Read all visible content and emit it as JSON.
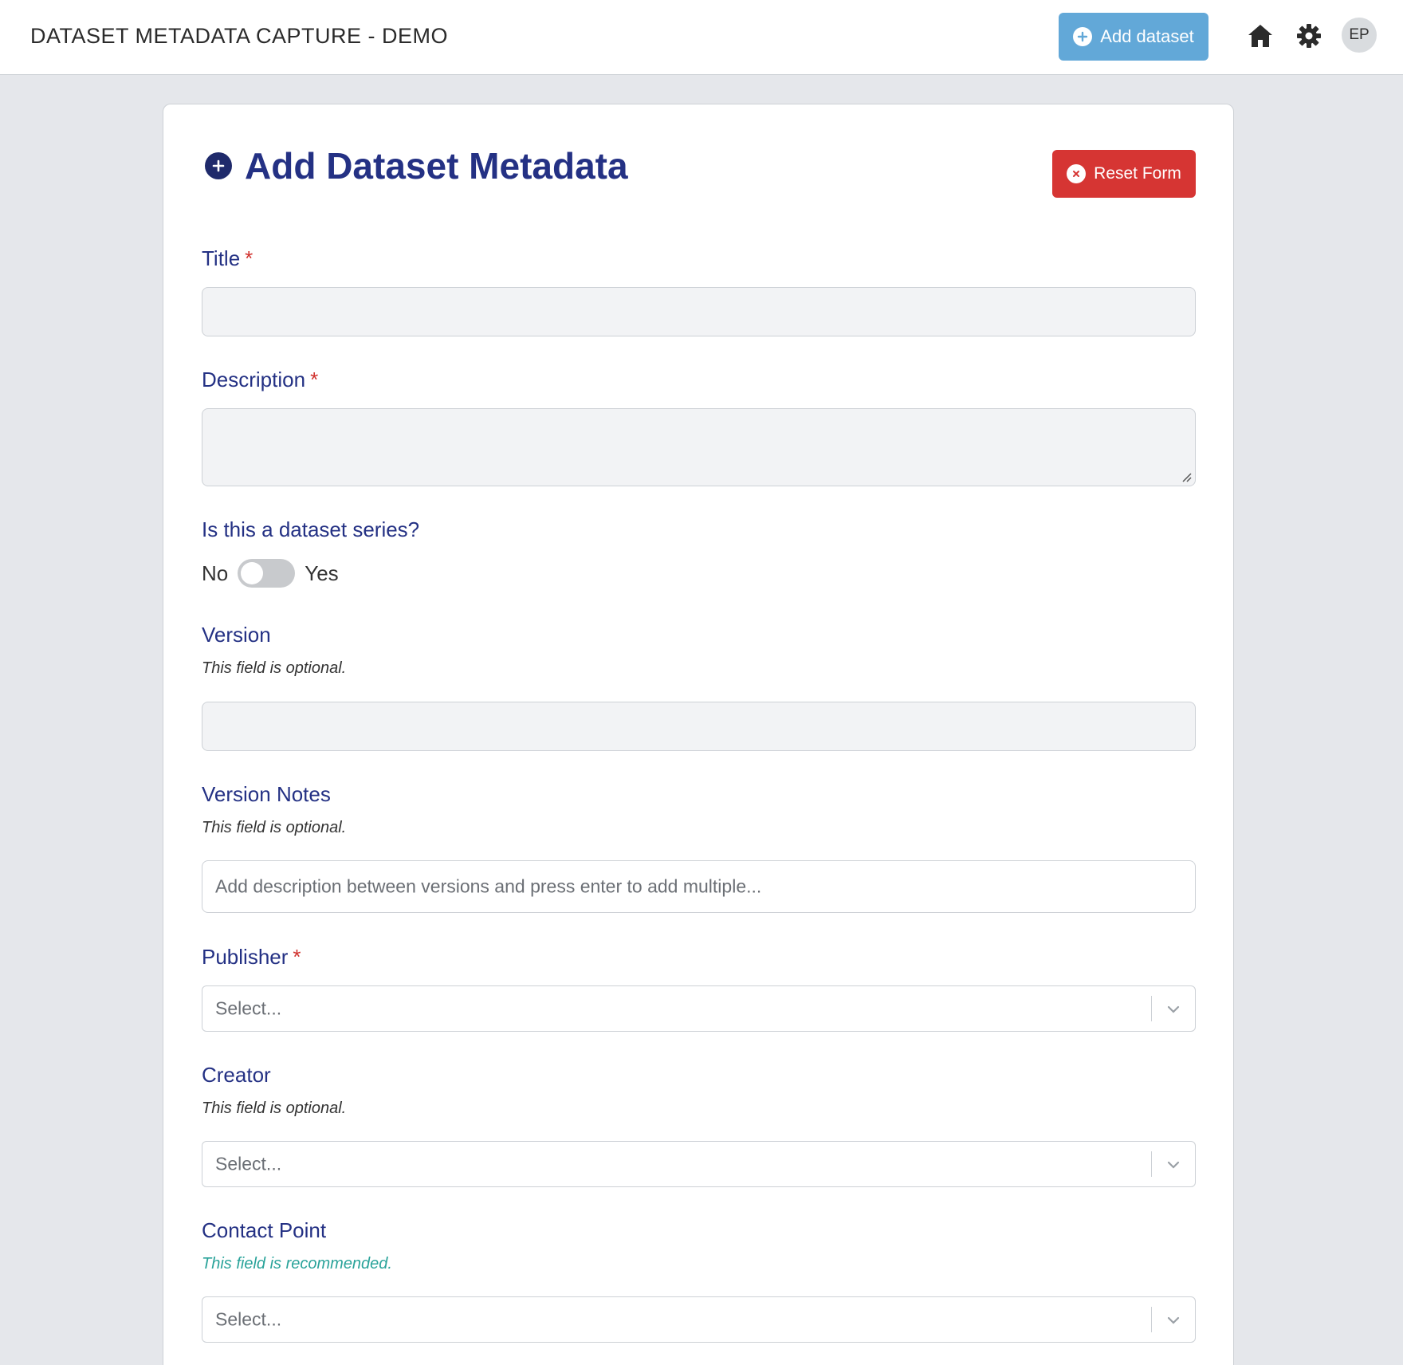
{
  "header": {
    "app_title": "DATASET METADATA CAPTURE - DEMO",
    "add_dataset_label": "Add dataset",
    "avatar_initials": "EP"
  },
  "form": {
    "heading": "Add Dataset Metadata",
    "reset_label": "Reset Form",
    "title_label": "Title",
    "description_label": "Description",
    "required_mark": "*",
    "series_question": "Is this a dataset series?",
    "toggle_no": "No",
    "toggle_yes": "Yes",
    "toggle_on": false,
    "version_label": "Version",
    "version_hint": "This field is optional.",
    "version_notes_label": "Version Notes",
    "version_notes_hint": "This field is optional.",
    "version_notes_placeholder": "Add description between versions and press enter to add multiple...",
    "publisher_label": "Publisher",
    "publisher_placeholder": "Select...",
    "creator_label": "Creator",
    "creator_hint": "This field is optional.",
    "creator_placeholder": "Select...",
    "contact_label": "Contact Point",
    "contact_hint": "This field is recommended.",
    "contact_placeholder": "Select..."
  },
  "colors": {
    "primary_button": "#62a8d8",
    "danger_button": "#d63533",
    "label_text": "#243184",
    "recommended_hint": "#2aa39a"
  }
}
